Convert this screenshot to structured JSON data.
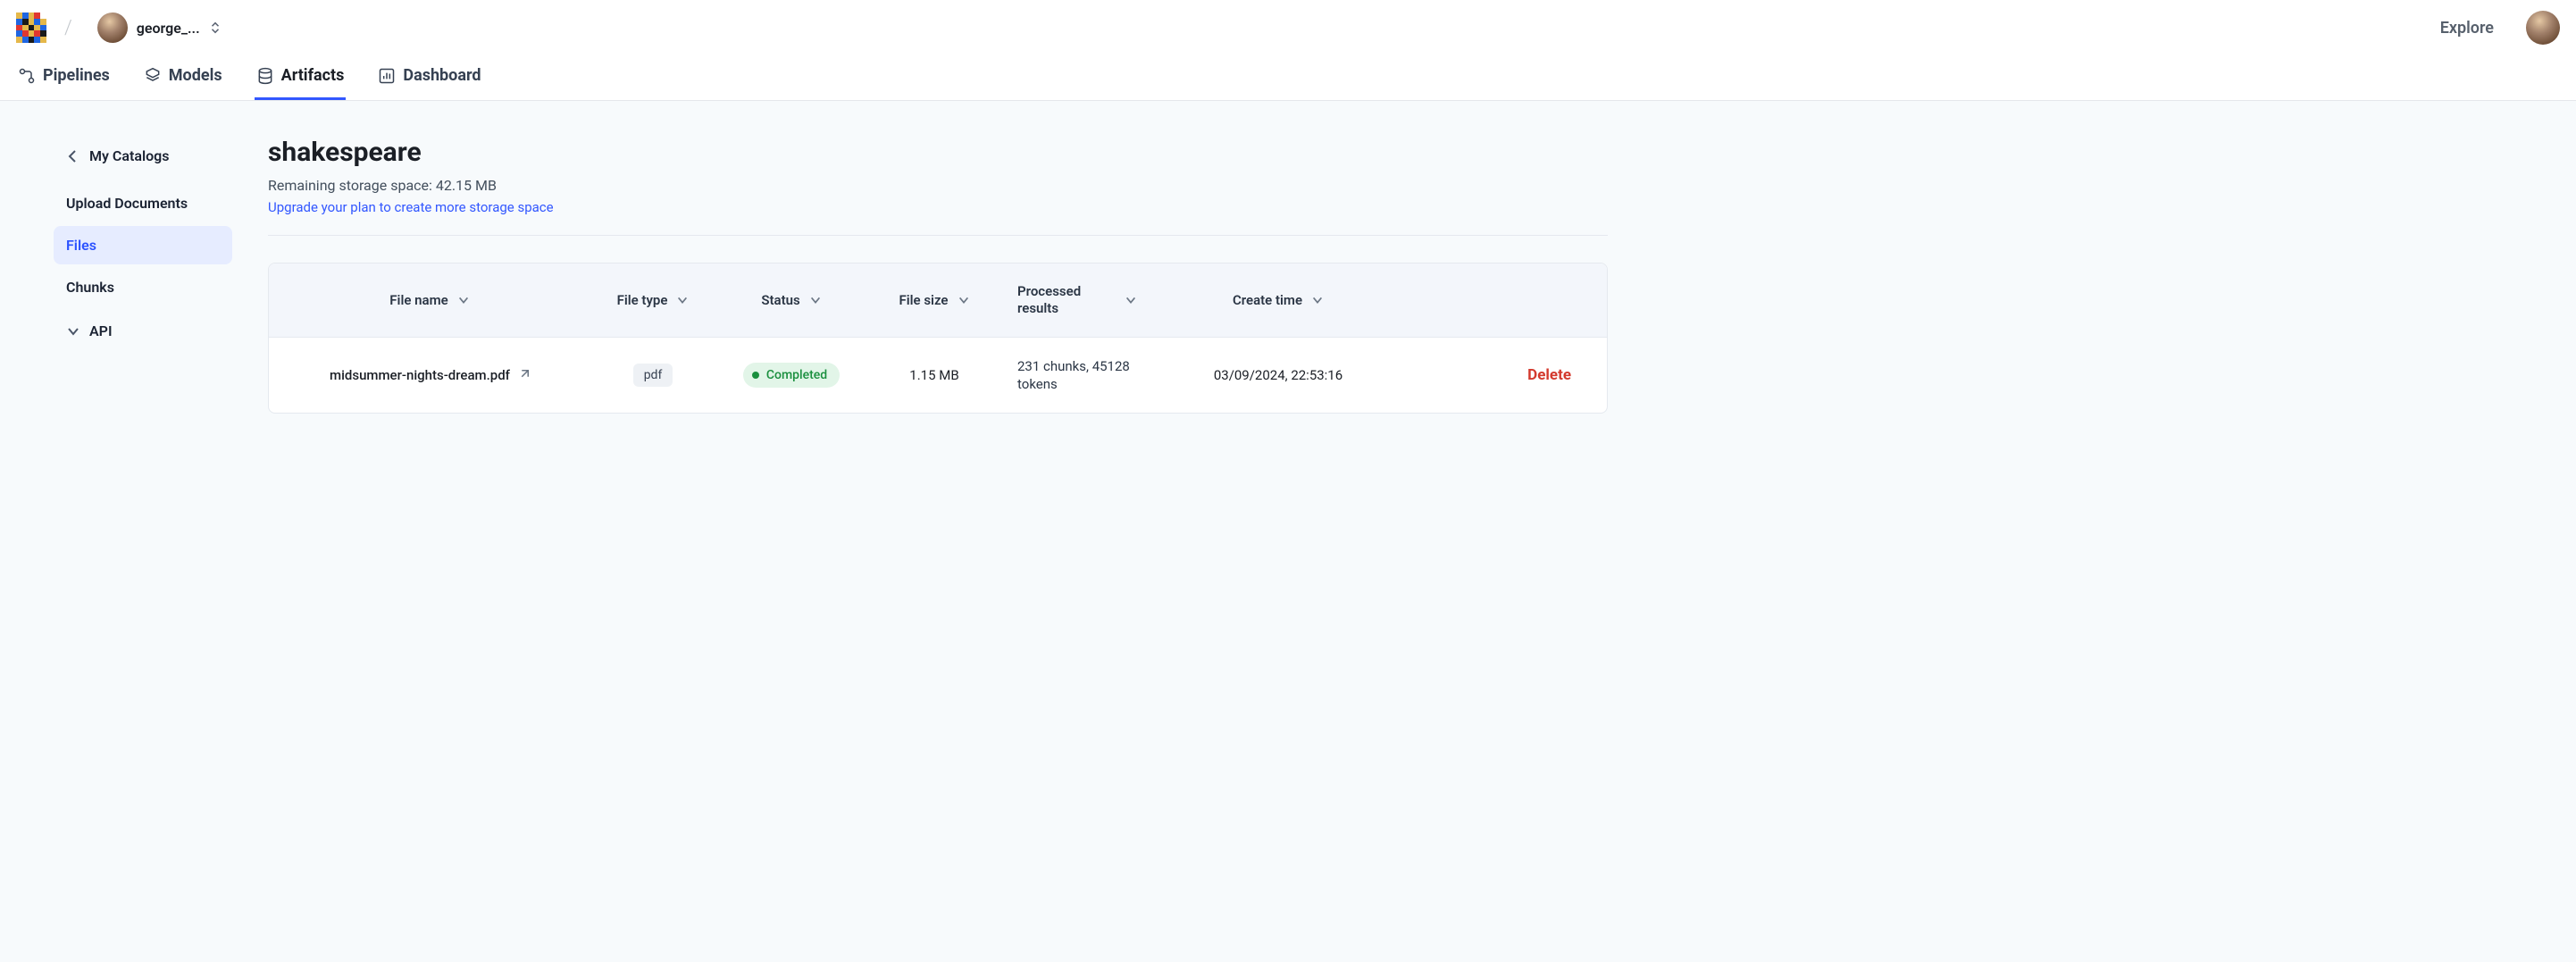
{
  "header": {
    "user_name": "george_...",
    "explore_label": "Explore"
  },
  "nav": {
    "pipelines": "Pipelines",
    "models": "Models",
    "artifacts": "Artifacts",
    "dashboard": "Dashboard",
    "active": "artifacts"
  },
  "sidebar": {
    "back_label": "My Catalogs",
    "items": [
      {
        "key": "upload",
        "label": "Upload Documents",
        "active": false
      },
      {
        "key": "files",
        "label": "Files",
        "active": true
      },
      {
        "key": "chunks",
        "label": "Chunks",
        "active": false
      }
    ],
    "api_label": "API"
  },
  "page": {
    "title": "shakespeare",
    "subtitle": "Remaining storage space: 42.15 MB",
    "upgrade_link": "Upgrade your plan to create more storage space"
  },
  "table": {
    "columns": {
      "file_name": "File name",
      "file_type": "File type",
      "status": "Status",
      "file_size": "File size",
      "processed": "Processed results",
      "create_time": "Create time"
    },
    "rows": [
      {
        "file_name": "midsummer-nights-dream.pdf",
        "file_type": "pdf",
        "status": "Completed",
        "file_size": "1.15 MB",
        "processed": "231 chunks, 45128 tokens",
        "create_time": "03/09/2024, 22:53:16",
        "action_label": "Delete"
      }
    ]
  }
}
